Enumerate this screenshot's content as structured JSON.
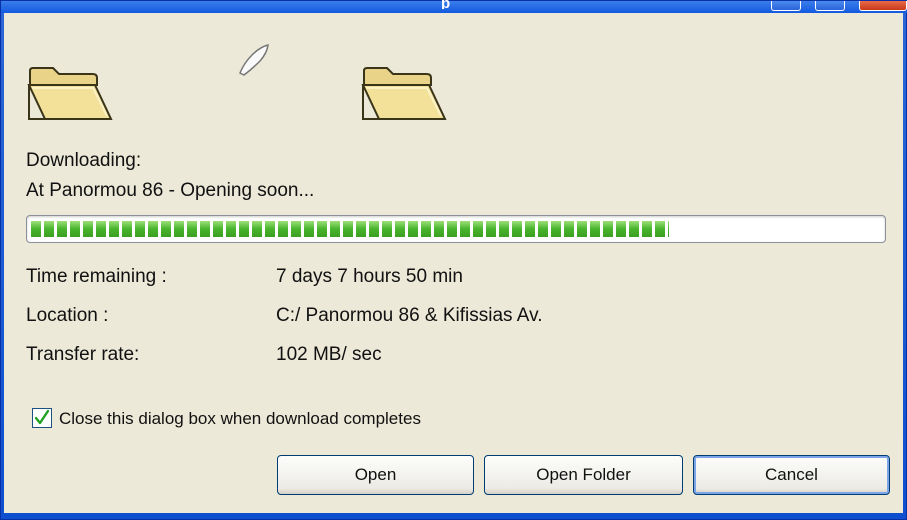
{
  "window": {
    "title": "p",
    "controls": [
      "minimize-icon",
      "maximize-icon",
      "close-icon"
    ]
  },
  "icons": {
    "source_folder": "folder-icon",
    "flying_paper": "document-icon",
    "destination_folder": "folder-icon"
  },
  "download": {
    "status_label": "Downloading:",
    "item_name": "At Panormou 86 - Opening soon...",
    "progress_percent": 75
  },
  "details": [
    {
      "label": "Time remaining :",
      "value": "7 days 7 hours 50 min"
    },
    {
      "label": "Location :",
      "value": "C:/ Panormou 86 & Kifissias Av."
    },
    {
      "label": "Transfer rate:",
      "value": "102 MB/ sec"
    }
  ],
  "options": {
    "close_on_complete_label": "Close this  dialog box when download completes",
    "close_on_complete_checked": true
  },
  "buttons": {
    "open": "Open",
    "open_folder": "Open Folder",
    "cancel": "Cancel"
  },
  "colors": {
    "progress_green": "#48b32c",
    "title_blue": "#0d4fcf",
    "dialog_bg": "#ece9d8"
  }
}
